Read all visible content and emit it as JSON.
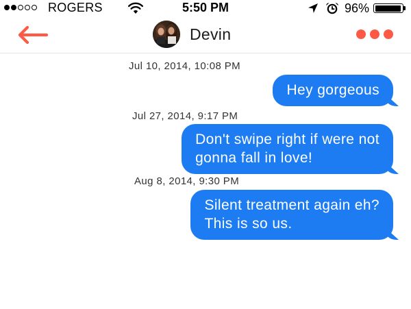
{
  "status_bar": {
    "signal_bars_filled": 2,
    "signal_bars_total": 5,
    "carrier": "ROGERS",
    "time": "5:50 PM",
    "battery_percent": "96%",
    "battery_level": 0.96,
    "icons": [
      "wifi-icon",
      "location-arrow-icon",
      "alarm-clock-icon",
      "battery-icon"
    ]
  },
  "nav": {
    "back_icon": "arrow-left-icon",
    "contact_name": "Devin",
    "more_icon": "more-dots-icon"
  },
  "messages": [
    {
      "timestamp": "Jul 10, 2014, 10:08 PM",
      "lines": [
        "Hey gorgeous"
      ]
    },
    {
      "timestamp": "Jul 27, 2014, 9:17 PM",
      "lines": [
        "Don't swipe right if were not",
        "gonna fall in love!"
      ]
    },
    {
      "timestamp": "Aug 8, 2014, 9:30 PM",
      "lines": [
        "Silent treatment again eh?",
        "This is so us."
      ]
    }
  ],
  "colors": {
    "accent": "#fc5a45",
    "bubble": "#1d7cf2"
  }
}
